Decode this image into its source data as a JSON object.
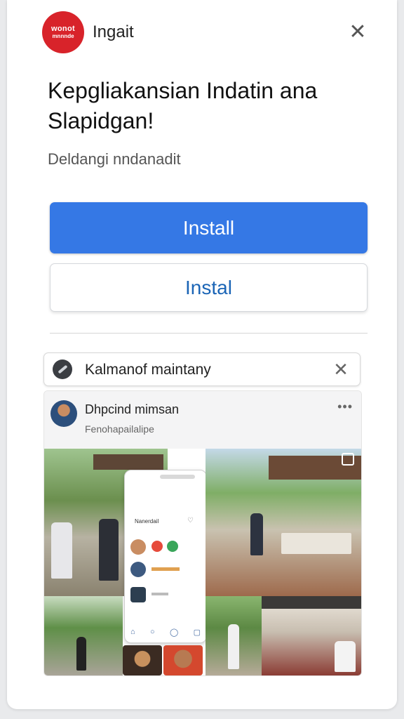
{
  "app": {
    "logo_line1": "wonot",
    "logo_line2": "mnnnde",
    "name": "Ingait",
    "close_glyph": "✕"
  },
  "headline": "Kepgliakansian Indatin ana Slapidgan!",
  "subtitle": "Deldangi nndanadit",
  "buttons": {
    "primary_label": "Install",
    "secondary_label": "Instal"
  },
  "notification": {
    "text": "Kalmanof maintany",
    "close_glyph": "✕",
    "icon": "toggle-icon"
  },
  "post": {
    "author": "Dhpcind mimsan",
    "subtitle": "Fenohapailalipe",
    "more_glyph": "•••",
    "phone_label": "Nanerdail",
    "phone_heart": "♡",
    "phone_nav": [
      "⌂",
      "○",
      "◯",
      "▢"
    ]
  },
  "colors": {
    "primary": "#3578e5",
    "secondary_text": "#1b65b6",
    "logo_bg": "#d8232a"
  }
}
